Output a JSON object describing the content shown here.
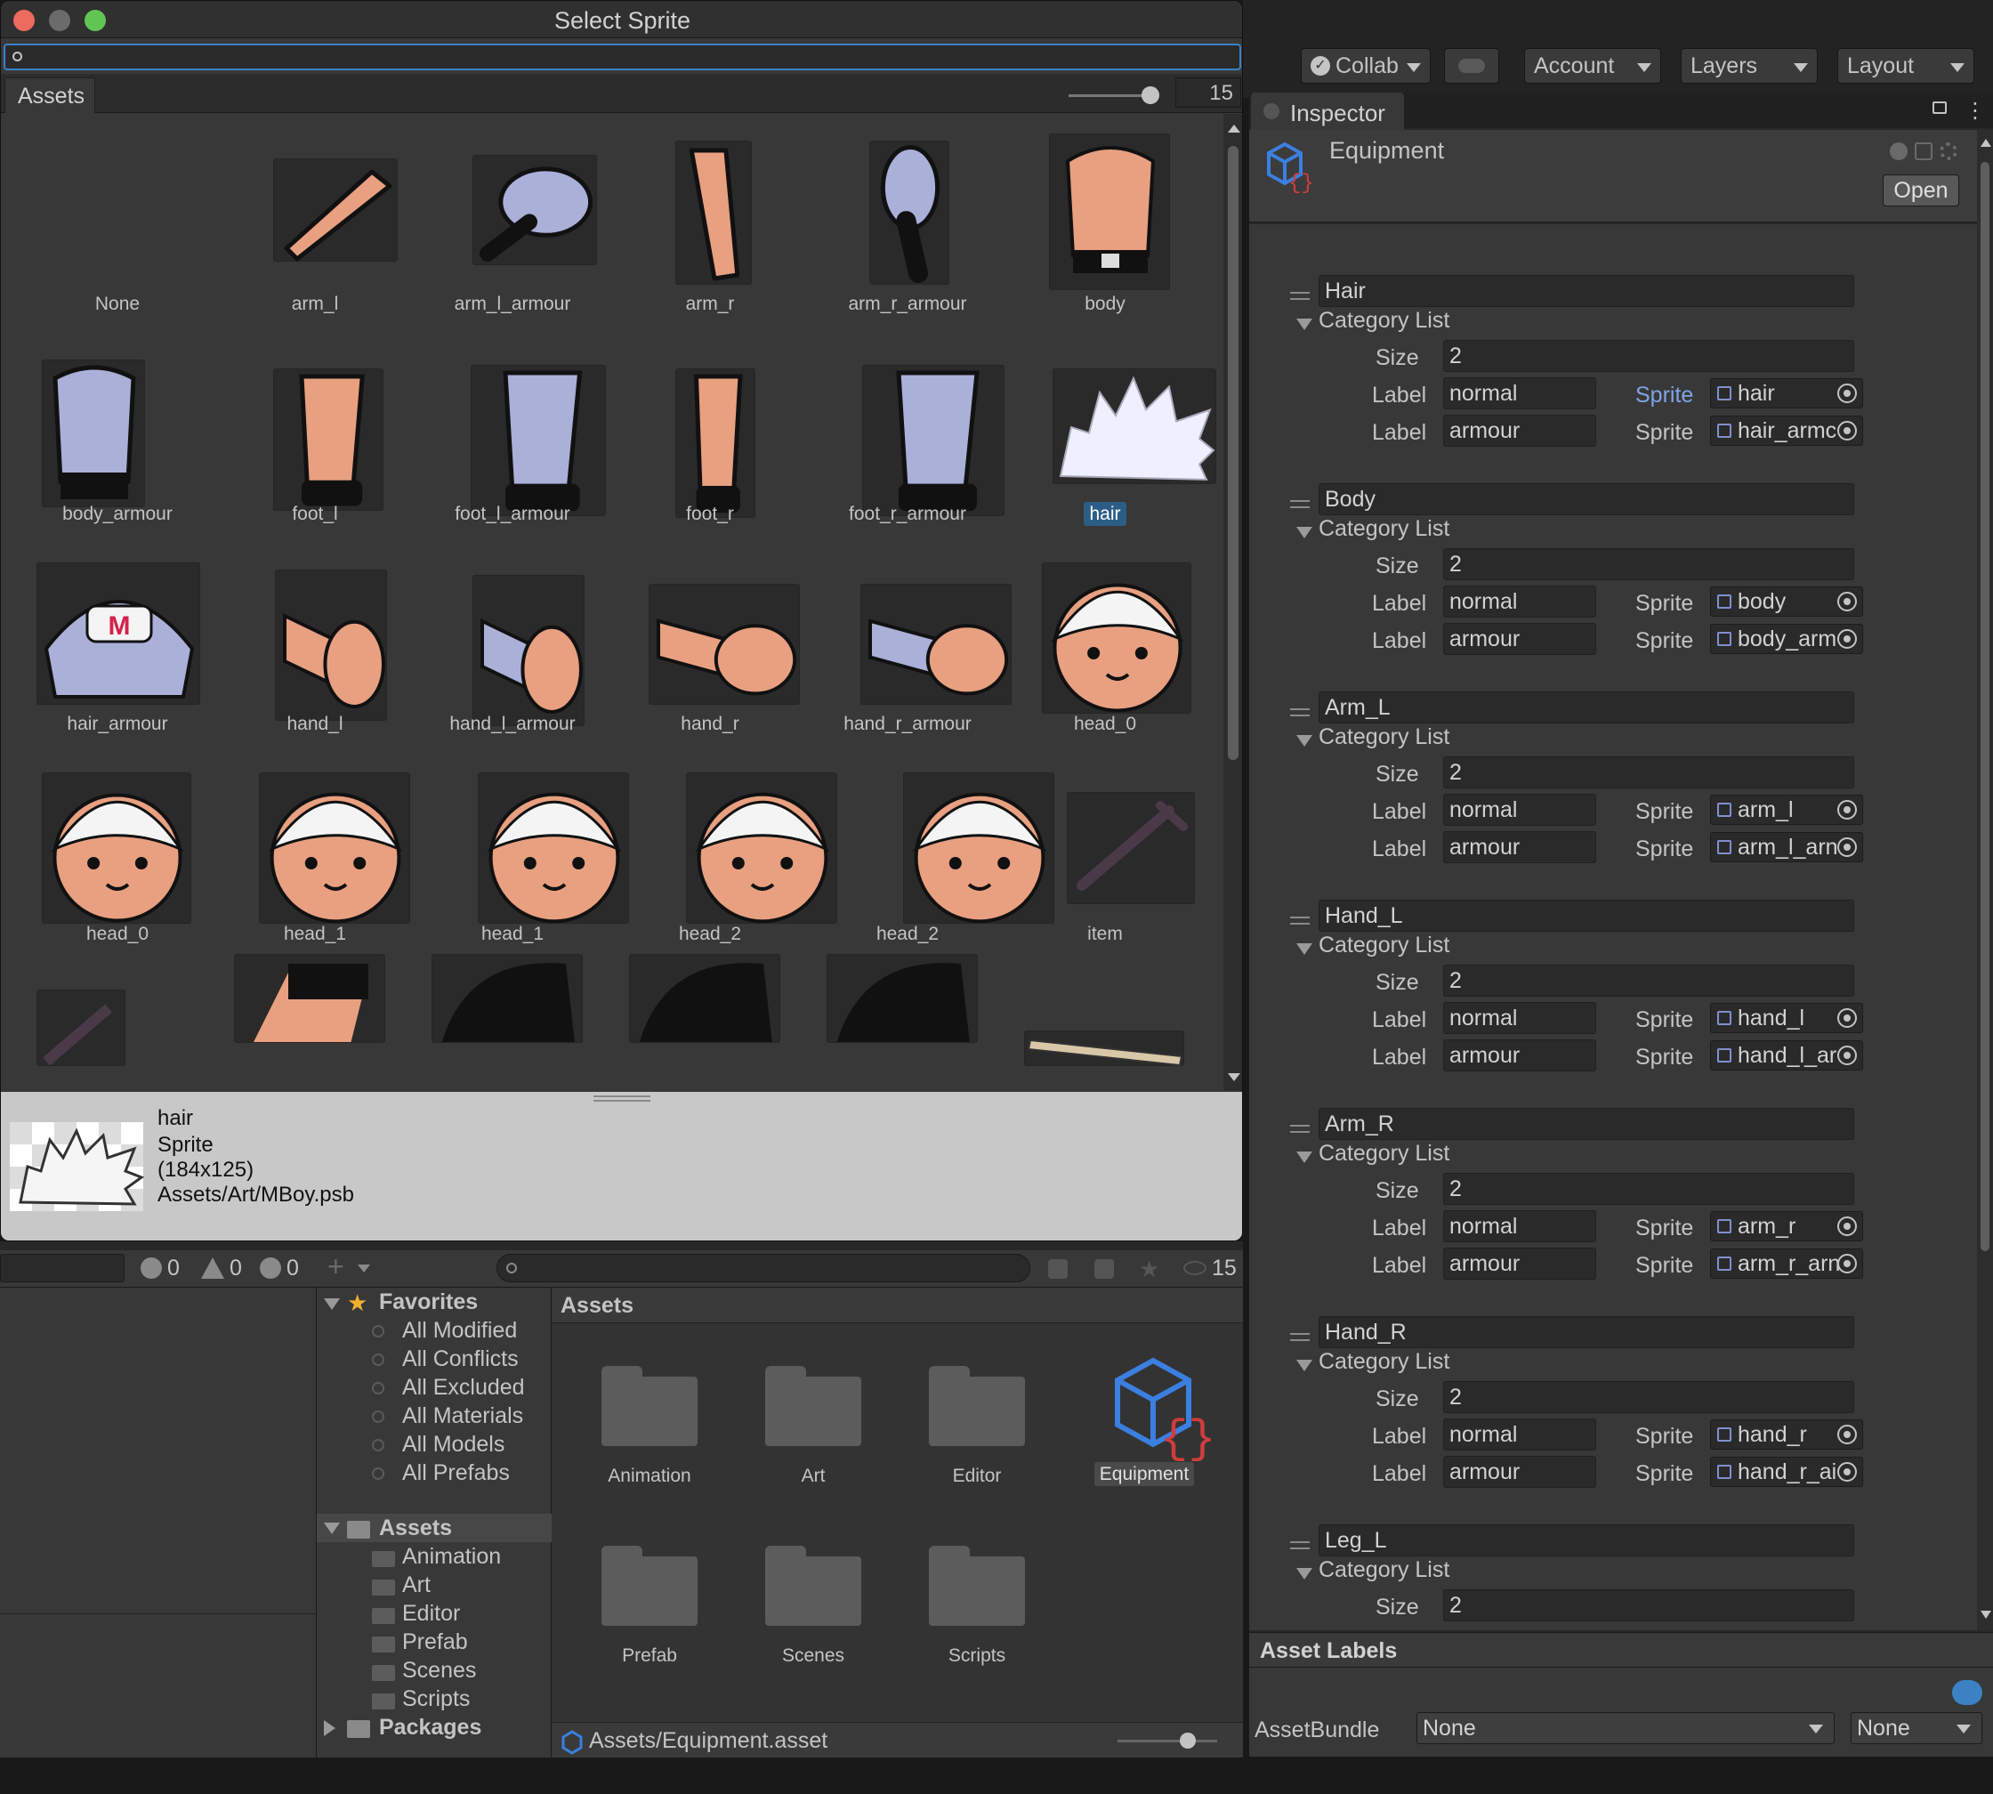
{
  "dialog": {
    "title": "Select Sprite",
    "search": {
      "value": "",
      "placeholder": ""
    },
    "tab": "Assets",
    "zoom_value": "15",
    "items": [
      {
        "name": "None"
      },
      {
        "name": "arm_l"
      },
      {
        "name": "arm_l_armour"
      },
      {
        "name": "arm_r"
      },
      {
        "name": "arm_r_armour"
      },
      {
        "name": "body"
      },
      {
        "name": "body_armour"
      },
      {
        "name": "foot_l"
      },
      {
        "name": "foot_l_armour"
      },
      {
        "name": "foot_r"
      },
      {
        "name": "foot_r_armour"
      },
      {
        "name": "hair",
        "selected": true
      },
      {
        "name": "hair_armour"
      },
      {
        "name": "hand_l"
      },
      {
        "name": "hand_l_armour"
      },
      {
        "name": "hand_r"
      },
      {
        "name": "hand_r_armour"
      },
      {
        "name": "head_0"
      },
      {
        "name": "head_0"
      },
      {
        "name": "head_1"
      },
      {
        "name": "head_1"
      },
      {
        "name": "head_2"
      },
      {
        "name": "head_2"
      },
      {
        "name": "item"
      }
    ],
    "preview": {
      "name": "hair",
      "type": "Sprite",
      "size": "(184x125)",
      "path": "Assets/Art/MBoy.psb"
    }
  },
  "toolbar": {
    "collab": "Collab",
    "account": "Account",
    "layers": "Layers",
    "layout": "Layout"
  },
  "inspector": {
    "tab": "Inspector",
    "object_name": "Equipment",
    "open_label": "Open",
    "category_list_label": "Category List",
    "size_label": "Size",
    "label_label": "Label",
    "sprite_label": "Sprite",
    "categories": [
      {
        "name": "Hair",
        "size": "2",
        "entries": [
          {
            "label": "normal",
            "sprite": "hair"
          },
          {
            "label": "armour",
            "sprite": "hair_armc"
          }
        ]
      },
      {
        "name": "Body",
        "size": "2",
        "entries": [
          {
            "label": "normal",
            "sprite": "body"
          },
          {
            "label": "armour",
            "sprite": "body_arm"
          }
        ]
      },
      {
        "name": "Arm_L",
        "size": "2",
        "entries": [
          {
            "label": "normal",
            "sprite": "arm_l"
          },
          {
            "label": "armour",
            "sprite": "arm_l_arn"
          }
        ]
      },
      {
        "name": "Hand_L",
        "size": "2",
        "entries": [
          {
            "label": "normal",
            "sprite": "hand_l"
          },
          {
            "label": "armour",
            "sprite": "hand_l_ar"
          }
        ]
      },
      {
        "name": "Arm_R",
        "size": "2",
        "entries": [
          {
            "label": "normal",
            "sprite": "arm_r"
          },
          {
            "label": "armour",
            "sprite": "arm_r_arn"
          }
        ]
      },
      {
        "name": "Hand_R",
        "size": "2",
        "entries": [
          {
            "label": "normal",
            "sprite": "hand_r"
          },
          {
            "label": "armour",
            "sprite": "hand_r_ai"
          }
        ]
      },
      {
        "name": "Leg_L",
        "size": "2",
        "entries": []
      }
    ],
    "asset_labels": "Asset Labels",
    "assetbundle_label": "AssetBundle",
    "assetbundle_value": "None",
    "assetbundle_variant": "None"
  },
  "console": {
    "errors": "0",
    "warnings": "0",
    "infos": "0"
  },
  "project": {
    "hidden_count": "15",
    "favorites_label": "Favorites",
    "favorites": [
      "All Modified",
      "All Conflicts",
      "All Excluded",
      "All Materials",
      "All Models",
      "All Prefabs"
    ],
    "assets_label": "Assets",
    "asset_folders": [
      "Animation",
      "Art",
      "Editor",
      "Prefab",
      "Scenes",
      "Scripts"
    ],
    "packages_label": "Packages",
    "main_title": "Assets",
    "grid_items": [
      "Animation",
      "Art",
      "Editor",
      "Equipment",
      "Prefab",
      "Scenes",
      "Scripts"
    ],
    "status_path": "Assets/Equipment.asset"
  },
  "colors": {
    "selection": "#2c5d87",
    "focus": "#3b82c4",
    "icon_blue": "#3b7fe0",
    "icon_red": "#d23c3c"
  }
}
